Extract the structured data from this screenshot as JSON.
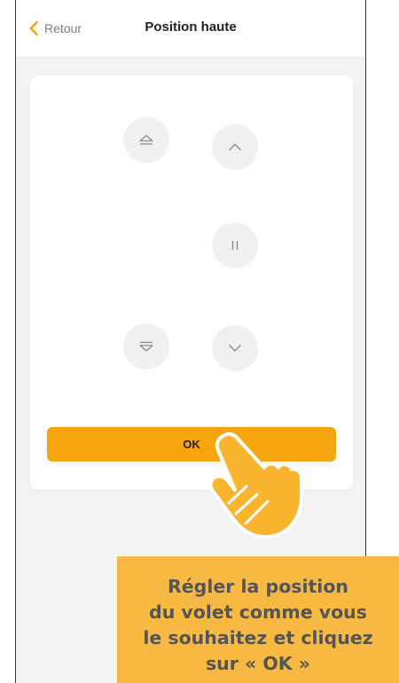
{
  "header": {
    "back_label": "Retour",
    "title": "Position haute"
  },
  "controls": {
    "ok_label": "OK"
  },
  "callout": {
    "lines": [
      "Régler la position",
      "du volet comme vous",
      "le souhaitez et cliquez",
      "sur « OK »"
    ]
  },
  "colors": {
    "accent": "#f6a50f",
    "callout_bg": "#f8b943",
    "hand": "#f7b42c",
    "button_bg": "#f0f0f0",
    "screen_bg": "#f3f3f3"
  },
  "icons": {
    "back": "chevron-left-icon",
    "top_position": "eject-up-icon",
    "up": "chevron-up-icon",
    "stop": "pause-icon",
    "bottom_position": "eject-down-icon",
    "down": "chevron-down-icon",
    "pointer": "hand-pointer-icon"
  }
}
